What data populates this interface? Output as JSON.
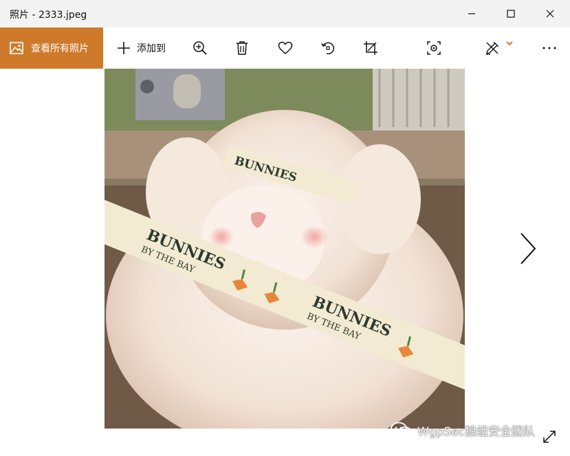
{
  "window": {
    "title": "照片 - 2333.jpeg"
  },
  "toolbar": {
    "view_all_label": "查看所有照片",
    "add_to_label": "添加到",
    "accent": "#cf7a2b",
    "icons": [
      "image-icon",
      "plus-icon",
      "zoom-in-icon",
      "delete-icon",
      "heart-icon",
      "rotate-icon",
      "crop-icon",
      "spot-fix-icon",
      "edit-draw-icon",
      "chevron-down-icon",
      "more-icon"
    ]
  },
  "photo": {
    "ribbon_text_1": "BUNNIES",
    "ribbon_text_2": "BY THE BAY"
  },
  "watermark": {
    "text": "WgpSec狼组安全团队"
  }
}
